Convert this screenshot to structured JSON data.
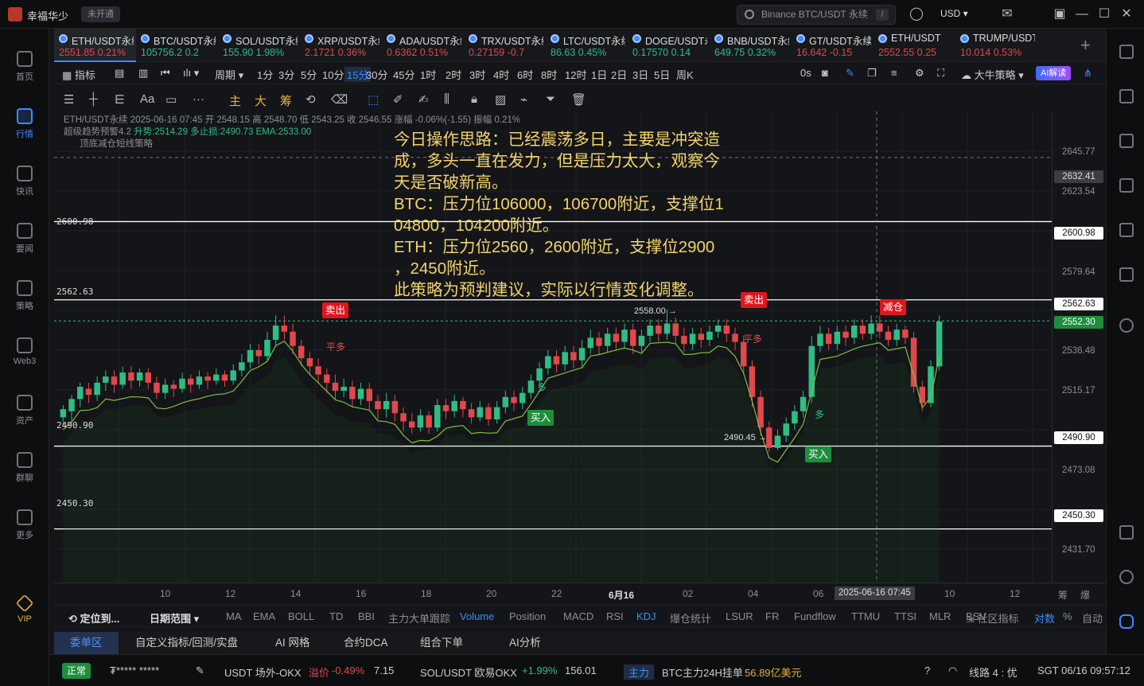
{
  "app": {
    "name": "幸福华少",
    "status": "未开通",
    "search_placeholder": "Binance BTC/USDT 永续",
    "search_shortcut": "/",
    "currency": "USD"
  },
  "left_nav": [
    {
      "label": "首页",
      "icon": "home-icon"
    },
    {
      "label": "行情",
      "icon": "market-chart-icon",
      "active": true
    },
    {
      "label": "快讯",
      "icon": "flash-news-icon"
    },
    {
      "label": "要闻",
      "icon": "news-icon"
    },
    {
      "label": "策略",
      "icon": "robot-strategy-icon"
    },
    {
      "label": "Web3",
      "icon": "web3-icon"
    },
    {
      "label": "资产",
      "icon": "wallet-icon"
    },
    {
      "label": "群聊",
      "icon": "group-chat-icon"
    },
    {
      "label": "更多",
      "icon": "grid-more-icon"
    },
    {
      "label": "VIP",
      "icon": "vip-diamond-icon"
    }
  ],
  "tickers": [
    {
      "symbol": "ETH/USDT永续",
      "price": "2551.85",
      "change": "0.21%",
      "dir": "down",
      "active": true
    },
    {
      "symbol": "BTC/USDT永续",
      "price": "105756.2",
      "change": "0.2",
      "dir": "up"
    },
    {
      "symbol": "SOL/USDT永续",
      "price": "155.90",
      "change": "1.98%",
      "dir": "up"
    },
    {
      "symbol": "XRP/USDT永续",
      "price": "2.1721",
      "change": "0.36%",
      "dir": "down"
    },
    {
      "symbol": "ADA/USDT永续",
      "price": "0.6362",
      "change": "0.51%",
      "dir": "down"
    },
    {
      "symbol": "TRX/USDT永续",
      "price": "0.27159",
      "change": "-0.7",
      "dir": "down"
    },
    {
      "symbol": "LTC/USDT永续",
      "price": "86.63",
      "change": "0.45%",
      "dir": "up"
    },
    {
      "symbol": "DOGE/USDT永续",
      "price": "0.17570",
      "change": "0.14",
      "dir": "up"
    },
    {
      "symbol": "BNB/USDT永续",
      "price": "649.75",
      "change": "0.32%",
      "dir": "up"
    },
    {
      "symbol": "GT/USDT永续",
      "price": "16.642",
      "change": "-0.15",
      "dir": "down"
    },
    {
      "symbol": "ETH/USDT",
      "price": "2552.55",
      "change": "0.25",
      "dir": "down"
    },
    {
      "symbol": "TRUMP/USDT",
      "price": "10.014",
      "change": "0.53%",
      "dir": "down"
    }
  ],
  "toolbar1": {
    "indicators": "指标",
    "period": "周期",
    "timeframes": [
      "1分",
      "3分",
      "5分",
      "10分",
      "15分",
      "30分",
      "45分",
      "1时",
      "2时",
      "3时",
      "4时",
      "6时",
      "8时",
      "12时",
      "1日",
      "2日",
      "3日",
      "5日",
      "周K"
    ],
    "selected_timeframe": "15分",
    "countdown": "0s",
    "strategy": "大牛策略",
    "ai_button": "AI解读"
  },
  "toolbar2": [
    "主",
    "大",
    "筹"
  ],
  "info": {
    "line1": "ETH/USDT永续  2025-06-16 07:45  开 2548.15  高 2548.70  低 2543.25  收 2546.55  涨幅 -0.06%(-1.55)  振幅 0.21%",
    "line2a": "超级趋势预警4.2",
    "line2b": "升势:2514.29  多止损:2490.73  EMA:2533.00",
    "line3": "顶底减仓短线策略"
  },
  "note_lines": [
    "今日操作思路：已经震荡多日，主要是冲突造",
    "成，多头一直在发力，但是压力太大，观察今",
    "天是否破新高。",
    "BTC：压力位106000，106700附近，支撑位1",
    "04800，104200附近。",
    "ETH：压力位2560，2600附近，支撑位2900",
    "，2450附近。",
    "此策略为预判建议，实际以行情变化调整。"
  ],
  "levels": [
    "2600.98",
    "2562.63",
    "2490.90",
    "2450.30"
  ],
  "price_axis": [
    "2645.77",
    "2623.54",
    "2600.98",
    "2579.64",
    "2562.63",
    "2552.30",
    "2536.48",
    "2515.17",
    "2490.90",
    "2473.08",
    "2450.30",
    "2431.70"
  ],
  "price_axis_cursor": "2632.41",
  "signals": {
    "sell": "卖出",
    "buy": "买入",
    "reduce": "减仓",
    "close_long": "平多",
    "long": "多"
  },
  "marks": {
    "high": "2558.00",
    "low": "2490.45"
  },
  "time_axis": [
    "10",
    "12",
    "14",
    "16",
    "18",
    "20",
    "22",
    "6月16",
    "02",
    "04",
    "06",
    "10",
    "12"
  ],
  "time_cursor": "2025-06-16 07:45",
  "indicator_bar": {
    "locate": "定位到...",
    "range": "日期范围",
    "items": [
      "MA",
      "EMA",
      "BOLL",
      "TD",
      "BBI",
      "主力大单跟踪",
      "Volume",
      "Position",
      "MACD",
      "RSI",
      "KDJ",
      "爆仓统计",
      "LSUR",
      "FR",
      "Fundflow",
      "TTMU",
      "TTSI",
      "MLR",
      "BSV"
    ],
    "community": "社区指标",
    "log": "对数",
    "pct": "%",
    "auto": "自动"
  },
  "bottom_tabs": [
    "委单区",
    "自定义指标/回测/实盘",
    "AI 网格",
    "合约DCA",
    "组合下单",
    "AI分析"
  ],
  "status_bar": {
    "normal": "正常",
    "account": "₮*****  *****",
    "otc": "USDT 场外-OKX",
    "premium_label": "溢价",
    "premium": "-0.49%",
    "otc_price": "7.15",
    "sol": "SOL/USDT 欧易OKX",
    "sol_change": "+1.99%",
    "sol_price": "156.01",
    "main_tag": "主力",
    "btc_main": "BTC主力24H挂单",
    "btc_amount": "56.89亿美元",
    "line": "线路 4 : 优",
    "time": "SGT 06/16 09:57:12"
  },
  "chart_data": {
    "type": "candlestick",
    "ylim": [
      2424,
      2655
    ],
    "candles": [
      [
        2505,
        2509,
        2501,
        2511
      ],
      [
        2508,
        2514,
        2503,
        2516
      ],
      [
        2514,
        2520,
        2510,
        2522
      ],
      [
        2519,
        2516,
        2512,
        2522
      ],
      [
        2516,
        2522,
        2513,
        2525
      ],
      [
        2522,
        2525,
        2518,
        2528
      ],
      [
        2525,
        2521,
        2517,
        2528
      ],
      [
        2521,
        2527,
        2519,
        2530
      ],
      [
        2527,
        2523,
        2519,
        2530
      ],
      [
        2523,
        2527,
        2520,
        2529
      ],
      [
        2527,
        2522,
        2519,
        2529
      ],
      [
        2522,
        2517,
        2514,
        2525
      ],
      [
        2517,
        2521,
        2514,
        2524
      ],
      [
        2521,
        2519,
        2515,
        2523
      ],
      [
        2519,
        2524,
        2517,
        2527
      ],
      [
        2524,
        2521,
        2517,
        2526
      ],
      [
        2521,
        2525,
        2519,
        2528
      ],
      [
        2525,
        2523,
        2519,
        2527
      ],
      [
        2523,
        2526,
        2521,
        2529
      ],
      [
        2526,
        2523,
        2520,
        2528
      ],
      [
        2523,
        2528,
        2521,
        2531
      ],
      [
        2528,
        2532,
        2525,
        2536
      ],
      [
        2532,
        2538,
        2529,
        2541
      ],
      [
        2538,
        2535,
        2531,
        2541
      ],
      [
        2535,
        2543,
        2533,
        2547
      ],
      [
        2543,
        2550,
        2540,
        2555
      ],
      [
        2550,
        2547,
        2543,
        2555
      ],
      [
        2547,
        2540,
        2536,
        2551
      ],
      [
        2540,
        2534,
        2530,
        2543
      ],
      [
        2534,
        2530,
        2526,
        2537
      ],
      [
        2530,
        2526,
        2522,
        2534
      ],
      [
        2526,
        2522,
        2517,
        2529
      ],
      [
        2522,
        2518,
        2514,
        2526
      ],
      [
        2518,
        2520,
        2515,
        2524
      ],
      [
        2520,
        2514,
        2510,
        2523
      ],
      [
        2514,
        2519,
        2511,
        2522
      ],
      [
        2519,
        2513,
        2508,
        2522
      ],
      [
        2513,
        2509,
        2504,
        2516
      ],
      [
        2509,
        2513,
        2505,
        2517
      ],
      [
        2513,
        2507,
        2503,
        2516
      ],
      [
        2507,
        2503,
        2498,
        2510
      ],
      [
        2503,
        2500,
        2497,
        2507
      ],
      [
        2500,
        2506,
        2498,
        2509
      ],
      [
        2506,
        2500,
        2497,
        2508
      ],
      [
        2500,
        2511,
        2498,
        2514
      ],
      [
        2511,
        2508,
        2504,
        2514
      ],
      [
        2508,
        2513,
        2505,
        2516
      ],
      [
        2513,
        2509,
        2505,
        2515
      ],
      [
        2509,
        2505,
        2502,
        2512
      ],
      [
        2505,
        2510,
        2503,
        2513
      ],
      [
        2510,
        2504,
        2501,
        2512
      ],
      [
        2504,
        2510,
        2502,
        2513
      ],
      [
        2510,
        2515,
        2507,
        2518
      ],
      [
        2515,
        2512,
        2508,
        2518
      ],
      [
        2512,
        2517,
        2509,
        2520
      ],
      [
        2517,
        2523,
        2514,
        2526
      ],
      [
        2523,
        2529,
        2520,
        2532
      ],
      [
        2529,
        2535,
        2526,
        2538
      ],
      [
        2535,
        2531,
        2527,
        2538
      ],
      [
        2531,
        2537,
        2528,
        2540
      ],
      [
        2537,
        2533,
        2529,
        2540
      ],
      [
        2533,
        2539,
        2530,
        2543
      ],
      [
        2539,
        2544,
        2536,
        2548
      ],
      [
        2544,
        2540,
        2536,
        2547
      ],
      [
        2540,
        2546,
        2537,
        2549
      ],
      [
        2546,
        2542,
        2538,
        2549
      ],
      [
        2542,
        2548,
        2539,
        2551
      ],
      [
        2548,
        2540,
        2536,
        2551
      ],
      [
        2540,
        2545,
        2537,
        2548
      ],
      [
        2545,
        2550,
        2542,
        2553
      ],
      [
        2550,
        2546,
        2542,
        2553
      ],
      [
        2546,
        2551,
        2543,
        2558
      ],
      [
        2551,
        2545,
        2541,
        2554
      ],
      [
        2545,
        2541,
        2537,
        2549
      ],
      [
        2541,
        2546,
        2538,
        2549
      ],
      [
        2546,
        2543,
        2539,
        2549
      ],
      [
        2543,
        2547,
        2540,
        2550
      ],
      [
        2547,
        2550,
        2544,
        2553
      ],
      [
        2550,
        2546,
        2542,
        2553
      ],
      [
        2546,
        2542,
        2538,
        2549
      ],
      [
        2542,
        2530,
        2526,
        2545
      ],
      [
        2530,
        2515,
        2510,
        2533
      ],
      [
        2515,
        2500,
        2496,
        2518
      ],
      [
        2500,
        2490,
        2488,
        2503
      ],
      [
        2490,
        2496,
        2489,
        2499
      ],
      [
        2496,
        2502,
        2493,
        2505
      ],
      [
        2502,
        2508,
        2499,
        2511
      ],
      [
        2508,
        2515,
        2505,
        2518
      ],
      [
        2515,
        2540,
        2512,
        2545
      ],
      [
        2540,
        2546,
        2537,
        2550
      ],
      [
        2546,
        2541,
        2538,
        2549
      ],
      [
        2541,
        2547,
        2538,
        2550
      ],
      [
        2547,
        2544,
        2540,
        2550
      ],
      [
        2544,
        2550,
        2541,
        2553
      ],
      [
        2550,
        2546,
        2543,
        2553
      ],
      [
        2546,
        2551,
        2543,
        2555
      ],
      [
        2551,
        2547,
        2544,
        2555
      ],
      [
        2547,
        2543,
        2540,
        2550
      ],
      [
        2543,
        2548,
        2540,
        2551
      ],
      [
        2548,
        2544,
        2541,
        2550
      ],
      [
        2544,
        2520,
        2517,
        2547
      ],
      [
        2520,
        2512,
        2508,
        2523
      ],
      [
        2512,
        2530,
        2510,
        2533
      ],
      [
        2530,
        2552,
        2528,
        2555
      ]
    ]
  }
}
